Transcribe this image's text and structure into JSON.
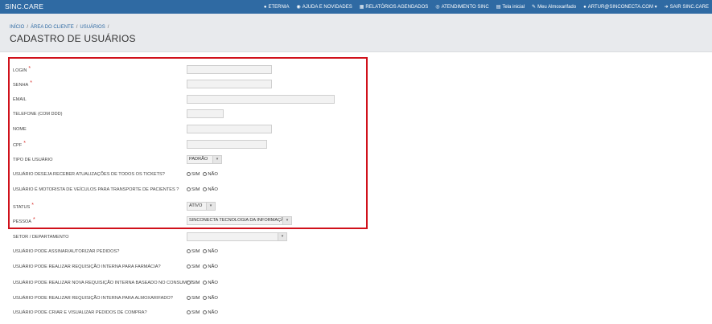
{
  "app": {
    "brand": "SINC.CARE"
  },
  "topnav": [
    {
      "icon": "chat-icon",
      "glyph": "●",
      "label": "ETERNIA"
    },
    {
      "icon": "rss-icon",
      "glyph": "◉",
      "label": "AJUDA E NOVIDADES"
    },
    {
      "icon": "calendar-icon",
      "glyph": "▦",
      "label": "RELATÓRIOS AGENDADOS"
    },
    {
      "icon": "support-icon",
      "glyph": "◎",
      "label": "ATENDIMENTO SINC"
    },
    {
      "icon": "clipboard-icon",
      "glyph": "▤",
      "label": "Tela inicial"
    },
    {
      "icon": "edit-icon",
      "glyph": "✎",
      "label": "Meu Almoxarifado"
    },
    {
      "icon": "user-icon",
      "glyph": "●",
      "label": "ARTUR@SINCONECTA.COM ▾"
    },
    {
      "icon": "logout-icon",
      "glyph": "➜",
      "label": "SAIR SINC.CARE"
    }
  ],
  "breadcrumb": {
    "items": [
      "INÍCIO",
      "ÁREA DO CLIENTE",
      "USUÁRIOS"
    ],
    "trail": "/"
  },
  "page": {
    "title": "CADASTRO DE USUÁRIOS"
  },
  "form": {
    "login": "LOGIN",
    "senha": "SENHA",
    "email": "EMAIL",
    "telefone": "TELEFONE (COM DDD)",
    "nome": "NOME",
    "cpf": "CPF",
    "tipo_usuario": {
      "label": "TIPO DE USUÁRIO",
      "value": "PADRÃO"
    },
    "atualizacoes": "USUÁRIO DESEJA RECEBER ATUALIZAÇÕES DE TODOS OS TICKETS?",
    "motorista": "USUÁRIO É MOTORISTA DE VEÍCULOS PARA TRANSPORTE DE PACIENTES ?",
    "status": {
      "label": "STATUS",
      "value": "ATIVO"
    },
    "pessoa": {
      "label": "PESSOA",
      "value": "SINCONECTA TECNOLOGIA DA INFORMAÇÃO"
    },
    "setor": {
      "label": "SETOR / DEPARTAMENTO",
      "value": ""
    },
    "assinar": "USUÁRIO PODE ASSINAR/AUTORIZAR PEDIDOS?",
    "req_farmacia": "USUÁRIO PODE REALIZAR REQUISIÇÃO INTERNA PARA FARMÁCIA?",
    "req_consumo": "USUÁRIO PODE REALIZAR NOVA REQUISIÇÃO INTERNA BASEADO NO CONSUMO?",
    "req_almox": "USUÁRIO PODE REALIZAR REQUISIÇÃO INTERNA PARA ALMOXARIFADO?",
    "pedidos_compra": "USUÁRIO PODE CRIAR E VISUALIZAR PEDIDOS DE COMPRA?",
    "sim": "SIM",
    "nao": "NÃO",
    "required_mark": "*",
    "arrow": "▾"
  },
  "colors": {
    "topbar": "#2f6aa3",
    "header": "#e8eaed",
    "highlight": "#d0111b",
    "required": "#d9312b"
  }
}
